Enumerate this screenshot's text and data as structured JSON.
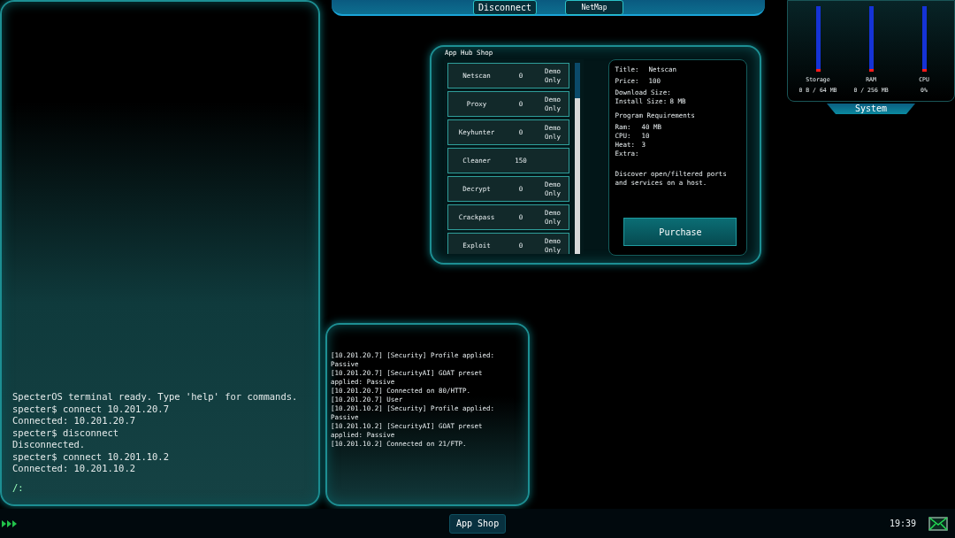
{
  "top_bar": {
    "buttons": [
      {
        "label": "Disconnect",
        "kind": "large"
      },
      {
        "label": "NetMap",
        "kind": "small"
      }
    ]
  },
  "terminal": {
    "lines": [
      "SpecterOS terminal ready. Type 'help' for commands.",
      "specter$ connect 10.201.20.7",
      "Connected: 10.201.20.7",
      "specter$ disconnect",
      "Disconnected.",
      "specter$ connect 10.201.10.2",
      "Connected: 10.201.10.2"
    ],
    "prompt": "/:"
  },
  "shop": {
    "title": "App Hub Shop",
    "items": [
      {
        "name": "Netscan",
        "price": "0",
        "note": "Demo Only"
      },
      {
        "name": "Proxy",
        "price": "0",
        "note": "Demo Only"
      },
      {
        "name": "Keyhunter",
        "price": "0",
        "note": "Demo Only"
      },
      {
        "name": "Cleaner",
        "price": "150"
      },
      {
        "name": "Decrypt",
        "price": "0",
        "note": "Demo Only"
      },
      {
        "name": "Crackpass",
        "price": "0",
        "note": "Demo Only"
      },
      {
        "name": "Exploit",
        "price": "0",
        "note": "Demo Only"
      }
    ],
    "details": {
      "fields": [
        {
          "label": "Title:",
          "value": "Netscan"
        },
        {
          "label": "Price:",
          "value": "100"
        }
      ],
      "sizes": [
        {
          "label": "Download Size:"
        },
        {
          "label": "Install Size:",
          "value": "8 MB"
        }
      ],
      "requirements_title": "Program Requirements",
      "requirements": [
        {
          "label": "Ram:",
          "value": "40 MB"
        },
        {
          "label": "CPU:",
          "value": "10"
        },
        {
          "label": "Heat:",
          "value": "3"
        },
        {
          "label": "Extra:"
        }
      ],
      "description": "Discover open/filtered ports and services on a host.",
      "purchase": "Purchase"
    }
  },
  "log": {
    "lines": [
      "[10.201.20.7] [Security] Profile applied: Passive",
      "[10.201.20.7] [SecurityAI] GOAT preset applied: Passive",
      "[10.201.20.7] Connected on 80/HTTP.",
      "[10.201.20.7] User",
      "[10.201.10.2] [Security] Profile applied: Passive",
      "[10.201.10.2] [SecurityAI] GOAT preset applied: Passive",
      "[10.201.10.2] Connected on 21/FTP."
    ]
  },
  "system": {
    "title": "System",
    "meters": [
      {
        "name": "Storage",
        "reading": "0 B / 64 MB",
        "level": 0
      },
      {
        "name": "RAM",
        "reading": "0 / 256 MB",
        "level": 0
      },
      {
        "name": "CPU",
        "reading": "0%",
        "level": 0
      }
    ]
  },
  "taskbar": {
    "apps": [
      {
        "label": "App Shop",
        "selected": true
      }
    ],
    "clock": "19:39"
  }
}
